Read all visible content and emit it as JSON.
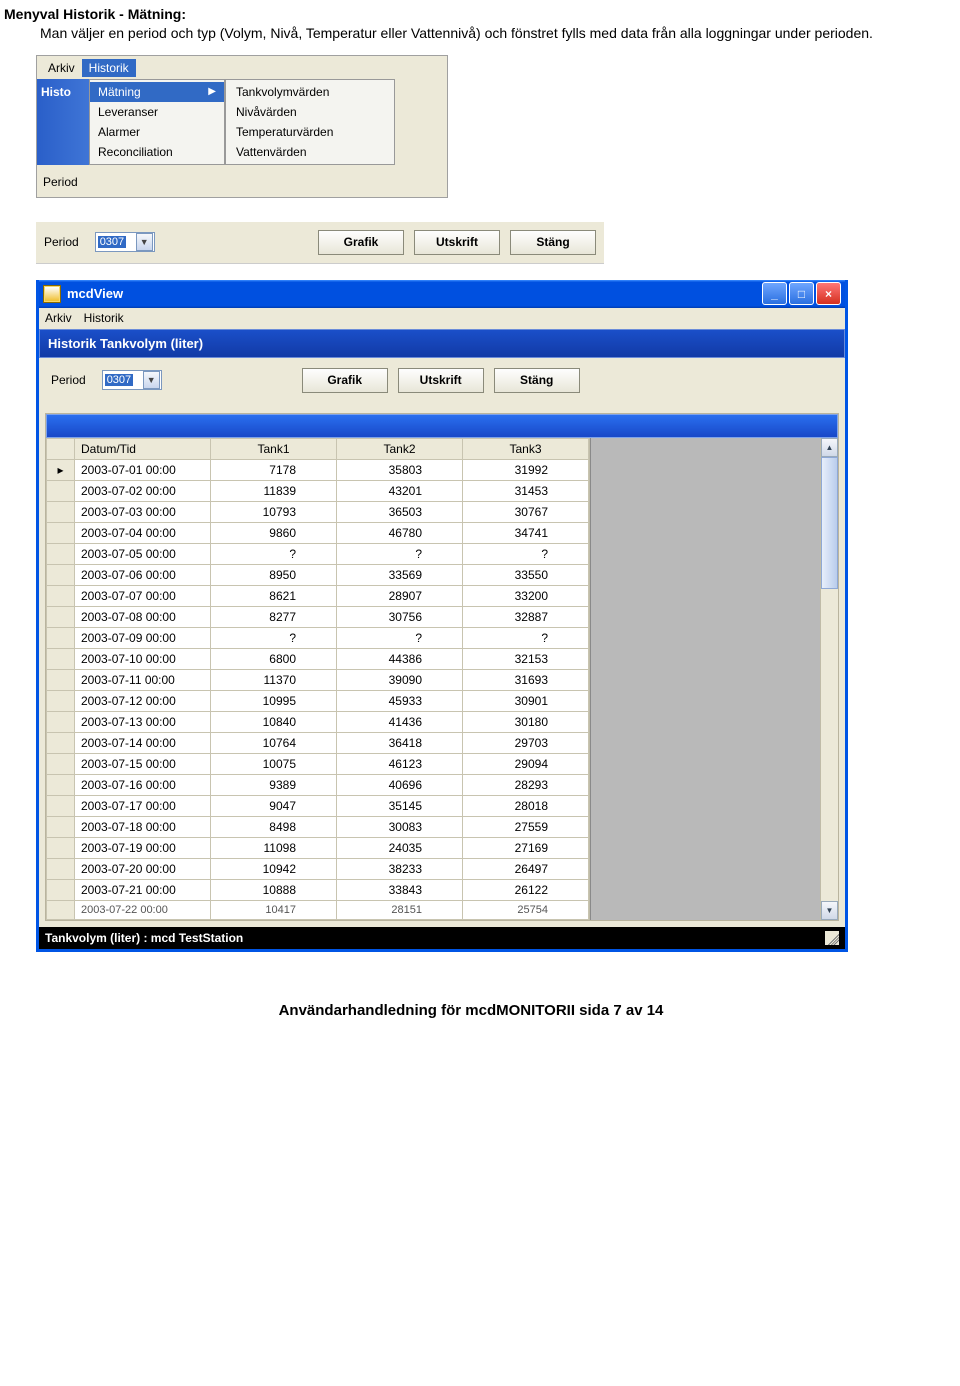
{
  "doc": {
    "heading": "Menyval Historik - Mätning:",
    "body": "Man väljer en period och typ (Volym, Nivå, Temperatur eller Vattennivå) och fönstret fylls med data från alla loggningar under perioden.",
    "footer": "Användarhandledning för mcdMONITORII sida  7 av 14"
  },
  "menu_shot": {
    "menubar": [
      "Arkiv",
      "Historik"
    ],
    "left_partial_title": "Histo",
    "left_period_label": "Period",
    "dropdown1": [
      {
        "label": "Mätning",
        "has_arrow": true,
        "highlight": true
      },
      {
        "label": "Leveranser",
        "has_arrow": false,
        "highlight": false
      },
      {
        "label": "Alarmer",
        "has_arrow": false,
        "highlight": false
      },
      {
        "label": "Reconciliation",
        "has_arrow": false,
        "highlight": false
      }
    ],
    "dropdown2": [
      "Tankvolymvärden",
      "Nivåvärden",
      "Temperaturvärden",
      "Vattenvärden"
    ]
  },
  "toolbar": {
    "period_label": "Period",
    "period_value": "0307",
    "buttons": [
      "Grafik",
      "Utskrift",
      "Stäng"
    ]
  },
  "window": {
    "title": "mcdView",
    "menubar": [
      "Arkiv",
      "Historik"
    ],
    "subtitle": "Historik Tankvolym (liter)",
    "status": "Tankvolym (liter)  :  mcd TestStation",
    "win_buttons": {
      "min": "_",
      "max": "□",
      "close": "×"
    },
    "table": {
      "headers": [
        "Datum/Tid",
        "Tank1",
        "Tank2",
        "Tank3"
      ],
      "rows": [
        {
          "dt": "2003-07-01 00:00",
          "t1": "7178",
          "t2": "35803",
          "t3": "31992",
          "ptr": true
        },
        {
          "dt": "2003-07-02 00:00",
          "t1": "11839",
          "t2": "43201",
          "t3": "31453"
        },
        {
          "dt": "2003-07-03 00:00",
          "t1": "10793",
          "t2": "36503",
          "t3": "30767"
        },
        {
          "dt": "2003-07-04 00:00",
          "t1": "9860",
          "t2": "46780",
          "t3": "34741"
        },
        {
          "dt": "2003-07-05 00:00",
          "t1": "?",
          "t2": "?",
          "t3": "?"
        },
        {
          "dt": "2003-07-06 00:00",
          "t1": "8950",
          "t2": "33569",
          "t3": "33550"
        },
        {
          "dt": "2003-07-07 00:00",
          "t1": "8621",
          "t2": "28907",
          "t3": "33200"
        },
        {
          "dt": "2003-07-08 00:00",
          "t1": "8277",
          "t2": "30756",
          "t3": "32887"
        },
        {
          "dt": "2003-07-09 00:00",
          "t1": "?",
          "t2": "?",
          "t3": "?"
        },
        {
          "dt": "2003-07-10 00:00",
          "t1": "6800",
          "t2": "44386",
          "t3": "32153"
        },
        {
          "dt": "2003-07-11 00:00",
          "t1": "11370",
          "t2": "39090",
          "t3": "31693"
        },
        {
          "dt": "2003-07-12 00:00",
          "t1": "10995",
          "t2": "45933",
          "t3": "30901"
        },
        {
          "dt": "2003-07-13 00:00",
          "t1": "10840",
          "t2": "41436",
          "t3": "30180"
        },
        {
          "dt": "2003-07-14 00:00",
          "t1": "10764",
          "t2": "36418",
          "t3": "29703"
        },
        {
          "dt": "2003-07-15 00:00",
          "t1": "10075",
          "t2": "46123",
          "t3": "29094"
        },
        {
          "dt": "2003-07-16 00:00",
          "t1": "9389",
          "t2": "40696",
          "t3": "28293"
        },
        {
          "dt": "2003-07-17 00:00",
          "t1": "9047",
          "t2": "35145",
          "t3": "28018"
        },
        {
          "dt": "2003-07-18 00:00",
          "t1": "8498",
          "t2": "30083",
          "t3": "27559"
        },
        {
          "dt": "2003-07-19 00:00",
          "t1": "11098",
          "t2": "24035",
          "t3": "27169"
        },
        {
          "dt": "2003-07-20 00:00",
          "t1": "10942",
          "t2": "38233",
          "t3": "26497"
        },
        {
          "dt": "2003-07-21 00:00",
          "t1": "10888",
          "t2": "33843",
          "t3": "26122"
        },
        {
          "dt": "2003-07-22 00:00",
          "t1": "10417",
          "t2": "28151",
          "t3": "25754",
          "partial": true
        }
      ]
    }
  }
}
